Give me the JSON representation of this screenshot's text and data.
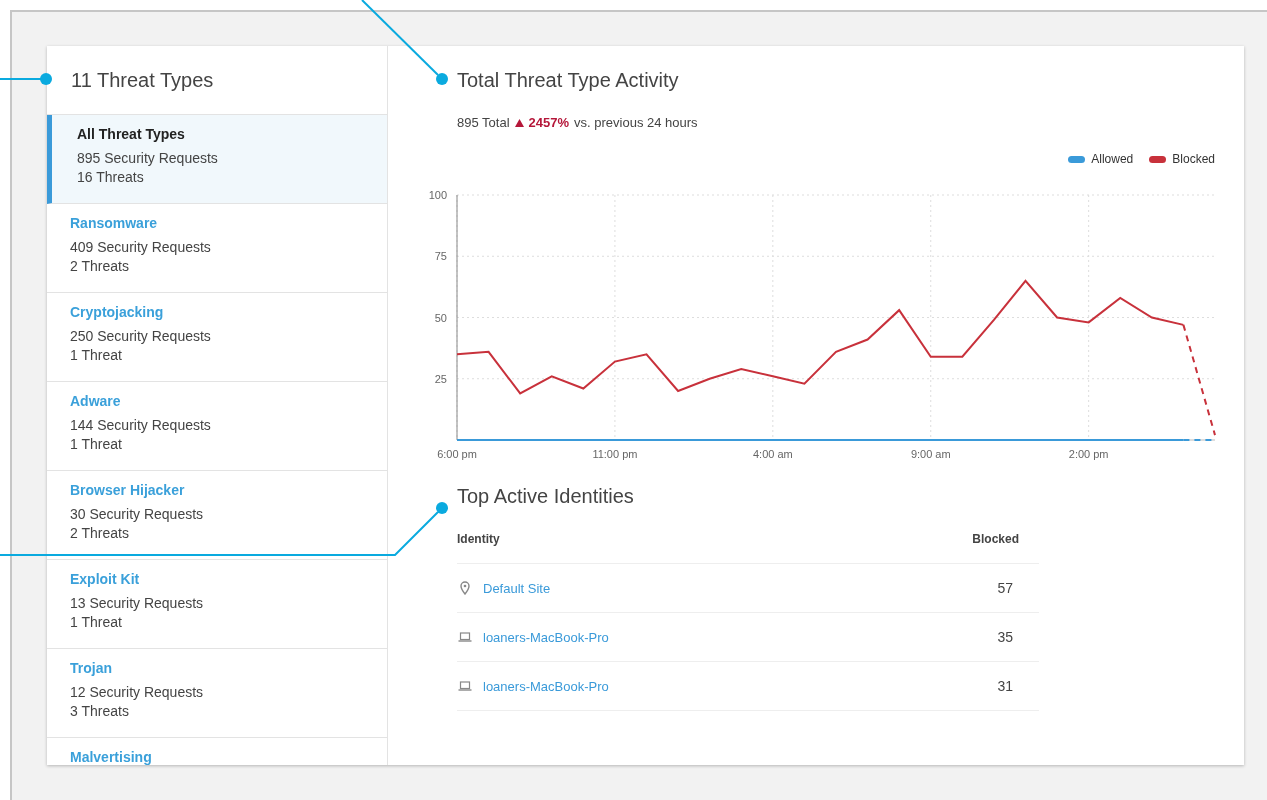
{
  "sidebar": {
    "title": "11 Threat Types",
    "items": [
      {
        "name": "All Threat Types",
        "requests": "895 Security Requests",
        "threats": "16 Threats",
        "selected": true
      },
      {
        "name": "Ransomware",
        "requests": "409 Security Requests",
        "threats": "2 Threats",
        "selected": false
      },
      {
        "name": "Cryptojacking",
        "requests": "250 Security Requests",
        "threats": "1 Threat",
        "selected": false
      },
      {
        "name": "Adware",
        "requests": "144 Security Requests",
        "threats": "1 Threat",
        "selected": false
      },
      {
        "name": "Browser Hijacker",
        "requests": "30 Security Requests",
        "threats": "2 Threats",
        "selected": false
      },
      {
        "name": "Exploit Kit",
        "requests": "13 Security Requests",
        "threats": "1 Threat",
        "selected": false
      },
      {
        "name": "Trojan",
        "requests": "12 Security Requests",
        "threats": "3 Threats",
        "selected": false
      },
      {
        "name": "Malvertising",
        "selected": false
      }
    ]
  },
  "activity": {
    "title": "Total Threat Type Activity",
    "total": "895 Total",
    "change": "2457%",
    "change_note": "vs. previous 24 hours",
    "chart_data": {
      "type": "line",
      "categories": [
        "6:00 pm",
        null,
        null,
        null,
        null,
        "11:00 pm",
        null,
        null,
        null,
        null,
        "4:00 am",
        null,
        null,
        null,
        null,
        "9:00 am",
        null,
        null,
        null,
        null,
        "2:00 pm",
        null,
        null,
        null,
        null
      ],
      "series": [
        {
          "name": "Allowed",
          "color": "#3a9ad9",
          "values": [
            0,
            0,
            0,
            0,
            0,
            0,
            0,
            0,
            0,
            0,
            0,
            0,
            0,
            0,
            0,
            0,
            0,
            0,
            0,
            0,
            0,
            0,
            0,
            0,
            0
          ]
        },
        {
          "name": "Blocked",
          "color": "#c8313b",
          "values": [
            35,
            36,
            19,
            26,
            21,
            32,
            35,
            20,
            25,
            29,
            26,
            23,
            36,
            41,
            53,
            34,
            34,
            49,
            65,
            50,
            48,
            58,
            50,
            47,
            2
          ]
        }
      ],
      "ylim": [
        0,
        100
      ],
      "grid": true,
      "yticks": [
        25,
        50,
        75,
        100
      ]
    }
  },
  "identities": {
    "title": "Top Active Identities",
    "columns": [
      "Identity",
      "Blocked"
    ],
    "rows": [
      {
        "kind": "site",
        "identity": "Default Site",
        "blocked": "57"
      },
      {
        "kind": "laptop",
        "identity": "loaners-MacBook-Pro",
        "blocked": "35"
      },
      {
        "kind": "laptop",
        "identity": "loaners-MacBook-Pro",
        "blocked": "31"
      }
    ]
  }
}
